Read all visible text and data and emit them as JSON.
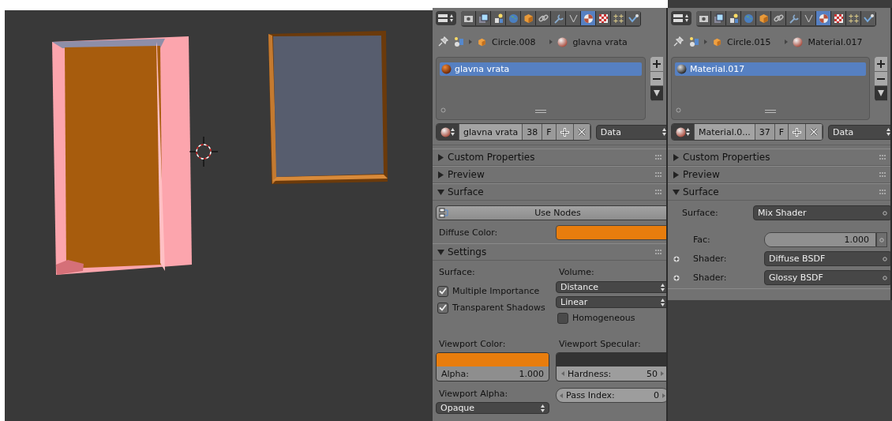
{
  "panels": [
    {
      "tabs": [
        {
          "kind": "render",
          "selected": false
        },
        {
          "kind": "layers",
          "selected": false
        },
        {
          "kind": "scene",
          "selected": false
        },
        {
          "kind": "world",
          "selected": false
        },
        {
          "kind": "object",
          "selected": false
        },
        {
          "kind": "constraints",
          "selected": false
        },
        {
          "kind": "modifiers",
          "selected": false
        },
        {
          "kind": "data",
          "selected": false
        },
        {
          "kind": "material",
          "selected": true
        },
        {
          "kind": "texture",
          "selected": false
        },
        {
          "kind": "particles",
          "selected": false
        },
        {
          "kind": "physics",
          "selected": false
        }
      ],
      "breadcrumb": {
        "object": "Circle.008",
        "material": "glavna vrata"
      },
      "slots": [
        {
          "name": "glavna vrata",
          "selected": true,
          "kind": "orange"
        }
      ],
      "id_block": {
        "name": "glavna vrata",
        "users": "38",
        "fake": "F",
        "link": "Data"
      },
      "sections": [
        {
          "kind": "plain",
          "title": "Custom Properties",
          "expanded": false
        },
        {
          "kind": "plain",
          "title": "Preview",
          "expanded": false
        },
        {
          "kind": "internal",
          "title": "Surface",
          "expanded": true,
          "use_nodes": "Use Nodes",
          "diffuse_label": "Diffuse Color:"
        },
        {
          "kind": "settings",
          "title": "Settings",
          "expanded": true,
          "surface_label": "Surface:",
          "volume_label": "Volume:",
          "checks": [
            {
              "label": "Multiple Importance",
              "checked": true
            },
            {
              "label": "Transparent Shadows",
              "checked": true
            }
          ],
          "dropdowns": [
            "Distance",
            "Linear"
          ],
          "homogeneous": {
            "label": "Homogeneous",
            "checked": false
          },
          "viewport_color": {
            "label": "Viewport Color:",
            "alpha_label": "Alpha:",
            "alpha_value": "1.000"
          },
          "viewport_specular": {
            "label": "Viewport Specular:",
            "hardness_label": "Hardness:",
            "hardness_value": "50",
            "pass_label": "Pass Index:",
            "pass_value": "0"
          },
          "viewport_alpha": {
            "label": "Viewport Alpha:",
            "value": "Opaque"
          }
        }
      ]
    },
    {
      "tabs": [
        {
          "kind": "render",
          "selected": false
        },
        {
          "kind": "layers",
          "selected": false
        },
        {
          "kind": "scene",
          "selected": false
        },
        {
          "kind": "world",
          "selected": false
        },
        {
          "kind": "object",
          "selected": false
        },
        {
          "kind": "constraints",
          "selected": false
        },
        {
          "kind": "modifiers",
          "selected": false
        },
        {
          "kind": "data",
          "selected": false
        },
        {
          "kind": "material",
          "selected": true
        },
        {
          "kind": "texture",
          "selected": false
        },
        {
          "kind": "particles",
          "selected": false
        },
        {
          "kind": "physics",
          "selected": false
        }
      ],
      "breadcrumb": {
        "object": "Circle.015",
        "material": "Material.017"
      },
      "slots": [
        {
          "name": "Material.017",
          "selected": true,
          "kind": "gray"
        }
      ],
      "id_block": {
        "name": "Material.0...",
        "users": "37",
        "fake": "F",
        "link": "Data"
      },
      "sections": [
        {
          "kind": "plain",
          "title": "Custom Properties",
          "expanded": false
        },
        {
          "kind": "plain",
          "title": "Preview",
          "expanded": false
        },
        {
          "kind": "nodes",
          "title": "Surface",
          "expanded": true,
          "rows": [
            {
              "kind": "dropdown",
              "label": "Surface:",
              "value": "Mix Shader",
              "expandable": false
            },
            {
              "kind": "slider",
              "label": "Fac:",
              "value": "1.000",
              "level": 1,
              "expandable": false
            },
            {
              "kind": "dropdown",
              "label": "Shader:",
              "value": "Diffuse BSDF",
              "expandable": true
            },
            {
              "kind": "dropdown",
              "label": "Shader:",
              "value": "Glossy BSDF",
              "expandable": true
            }
          ]
        },
        {
          "kind": "cut"
        }
      ]
    }
  ]
}
